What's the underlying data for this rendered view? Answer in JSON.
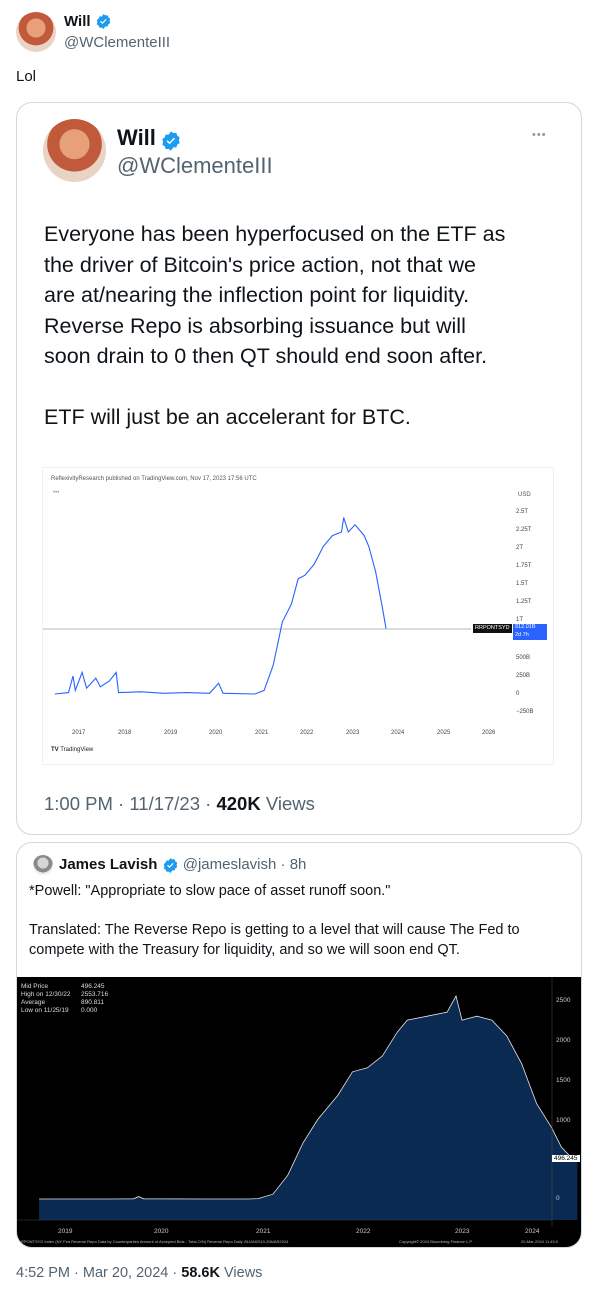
{
  "outer": {
    "name": "Will",
    "handle": "@WClementeIII",
    "text": "Lol",
    "footer": {
      "time": "4:52 PM",
      "dot": "·",
      "date": "Mar 20, 2024",
      "views_count": "58.6K",
      "views_label": "Views"
    }
  },
  "screenshot_tweet": {
    "name": "Will",
    "handle": "@WClementeIII",
    "more": "•••",
    "text_lines": [
      "Everyone has been hyperfocused on the ETF as",
      "the driver of Bitcoin's price action, not that we",
      "are at/nearing the inflection point for liquidity.",
      "Reverse Repo is absorbing issuance but will",
      "soon drain to 0 then QT should end soon after."
    ],
    "text2": "ETF will just be an accelerant for BTC.",
    "chart": {
      "header": "ReflexivityResearch published on TradingView.com, Nov 17, 2023 17:56 UTC",
      "menu": "•••",
      "currency": "USD",
      "y_labels": [
        "2.5T",
        "2.25T",
        "2T",
        "1.75T",
        "1.5T",
        "1.25T",
        "1T",
        "500B",
        "250B",
        "0",
        "−250B"
      ],
      "x_labels": [
        "2017",
        "2018",
        "2019",
        "2020",
        "2021",
        "2022",
        "2023",
        "2024",
        "2025",
        "2026"
      ],
      "symbol": "RRPONTSYD",
      "last_value": "912.01B",
      "last_sub": "2d 7h",
      "logo": "TradingView"
    },
    "footer": {
      "time": "1:00 PM",
      "date": "11/17/23",
      "views_count": "420K",
      "views_label": "Views",
      "dot": "·"
    }
  },
  "quote": {
    "name": "James Lavish",
    "handle": "@jameslavish",
    "dot": "·",
    "age": "8h",
    "line1": "*Powell: \"Appropriate to slow pace of asset runoff soon.\"",
    "line2a": "Translated: The Reverse Repo is getting to a level that will cause The Fed to",
    "line2b": "compete with the Treasury for liquidity, and so we will soon end QT.",
    "chart": {
      "legend": [
        {
          "label": "Mid Price",
          "value": "496.245"
        },
        {
          "label": "High on 12/30/22",
          "value": "2553.716"
        },
        {
          "label": "Average",
          "value": "890.811"
        },
        {
          "label": "Low on 11/25/19",
          "value": "0.000"
        }
      ],
      "y_labels": [
        "2500",
        "2000",
        "1500",
        "1000",
        "0"
      ],
      "x_labels": [
        "2019",
        "2020",
        "2021",
        "2022",
        "2023",
        "2024"
      ],
      "last_value": "496.245",
      "footnote_left": "RPONTSYD Index (NY Fed Reverse Repo Data by Counterparties Amount of Accepted Bids - Total O/N) Reverse Repo  Daily 26JAN2019-20MAR2024",
      "footnote_mid": "Copyright© 2024 Bloomberg Finance L.P.",
      "footnote_right": "20-Mar-2024 11:45:0"
    }
  },
  "colors": {
    "accent": "#1d9bf0",
    "muted": "#536471",
    "border": "#cfd9de",
    "chart_line": "#2962ff",
    "bloomberg_bg": "#000000",
    "bloomberg_fill": "#0b2a52"
  }
}
